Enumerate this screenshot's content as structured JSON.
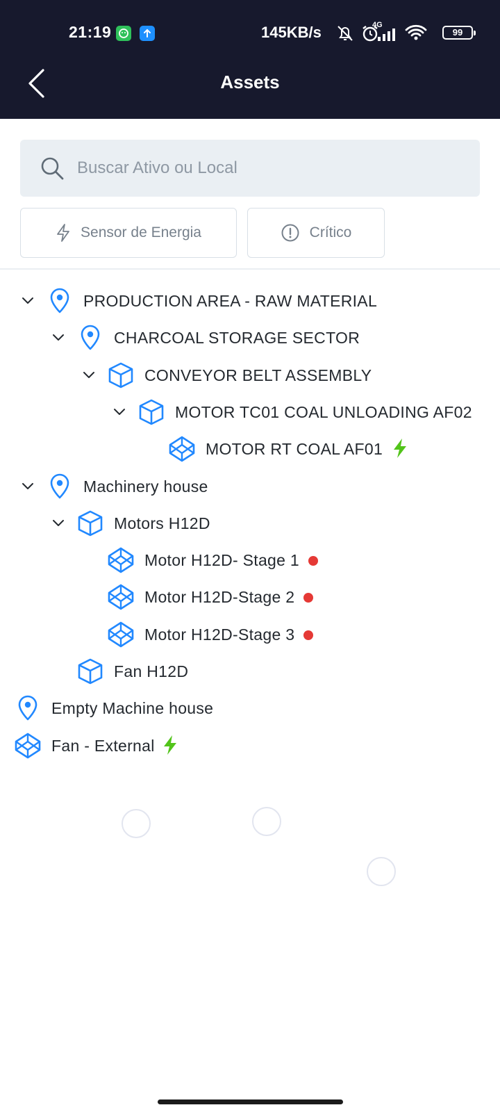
{
  "status_bar": {
    "time": "21:19",
    "network_speed": "145KB/s",
    "network_type": "4G",
    "battery": "99",
    "icons": [
      "app-notification-icon",
      "upload-icon",
      "mute-icon",
      "alarm-icon",
      "signal-icon",
      "wifi-icon",
      "battery-icon"
    ]
  },
  "header": {
    "title": "Assets",
    "back_icon": "chevron-left-icon"
  },
  "search": {
    "placeholder": "Buscar Ativo ou Local",
    "value": ""
  },
  "filters": {
    "energy_label": "Sensor de Energia",
    "critical_label": "Crítico"
  },
  "colors": {
    "header_bg": "#17192d",
    "icon_blue": "#2188ff",
    "energy_green": "#52c41a",
    "critical_red": "#e53935"
  },
  "tree": [
    {
      "label": "PRODUCTION AREA - RAW MATERIAL",
      "type": "location",
      "expanded": true,
      "level": 1
    },
    {
      "label": "CHARCOAL STORAGE SECTOR",
      "type": "location",
      "expanded": true,
      "level": 2
    },
    {
      "label": "CONVEYOR BELT ASSEMBLY",
      "type": "asset",
      "expanded": true,
      "level": 3
    },
    {
      "label": "MOTOR TC01 COAL UNLOADING AF02",
      "type": "asset",
      "expanded": true,
      "level": 4
    },
    {
      "label": "MOTOR RT COAL AF01",
      "type": "component",
      "status": "energy",
      "level": 5
    },
    {
      "label": "Machinery house",
      "type": "location",
      "expanded": true,
      "level": 1
    },
    {
      "label": "Motors H12D",
      "type": "asset",
      "expanded": true,
      "level": 2
    },
    {
      "label": "Motor H12D- Stage 1",
      "type": "component",
      "status": "critical",
      "level": 3
    },
    {
      "label": "Motor H12D-Stage 2",
      "type": "component",
      "status": "critical",
      "level": 3
    },
    {
      "label": "Motor H12D-Stage 3",
      "type": "component",
      "status": "critical",
      "level": 3
    },
    {
      "label": "Fan H12D",
      "type": "asset",
      "level": 2
    },
    {
      "label": "Empty Machine house",
      "type": "location",
      "level": 0
    },
    {
      "label": "Fan - External",
      "type": "component",
      "status": "energy",
      "level": 0
    }
  ]
}
